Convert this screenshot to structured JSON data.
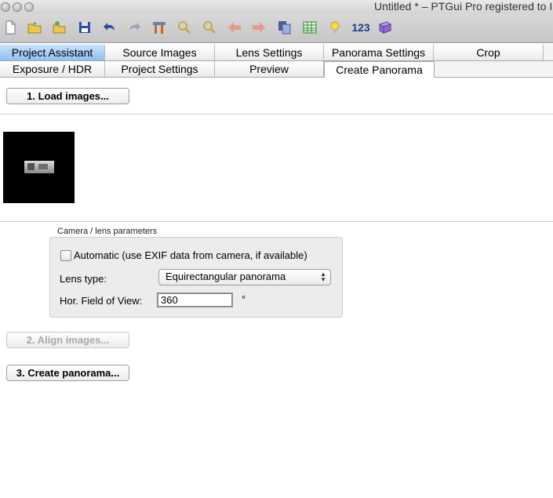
{
  "window": {
    "title": "Untitled * – PTGui Pro registered to I"
  },
  "toolbar": {
    "items": [
      "new-icon",
      "open-icon",
      "open-template-icon",
      "save-icon",
      "undo-icon",
      "redo-icon",
      "tools-icon",
      "zoom-in-icon",
      "zoom-out-icon",
      "previous-icon",
      "next-icon",
      "copy-icon",
      "table-icon",
      "lightbulb-icon",
      "number-icon",
      "book-icon"
    ],
    "numbering_label": "123"
  },
  "tabs": {
    "row1": [
      "Project Assistant",
      "Source Images",
      "Lens Settings",
      "Panorama Settings",
      "Crop"
    ],
    "row2": [
      "Exposure / HDR",
      "Project Settings",
      "Preview",
      "Create Panorama"
    ]
  },
  "assistant": {
    "load_button": "1. Load images...",
    "align_button": "2. Align images...",
    "create_button": "3. Create panorama..."
  },
  "lens": {
    "group_title": "Camera / lens parameters",
    "automatic_label": "Automatic (use EXIF data from camera, if available)",
    "automatic_checked": false,
    "lens_type_label": "Lens type:",
    "lens_type_value": "Equirectangular panorama",
    "fov_label": "Hor. Field of View:",
    "fov_value": "360",
    "fov_unit": "°"
  }
}
